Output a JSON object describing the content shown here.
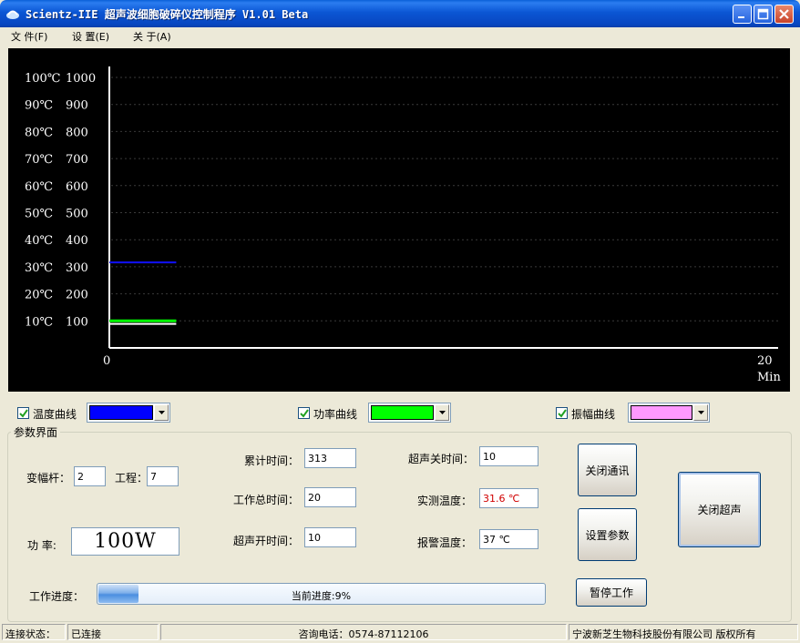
{
  "window": {
    "title": "Scientz-IIE 超声波细胞破碎仪控制程序 V1.01 Beta",
    "accent": "#0b56d4"
  },
  "menu": [
    {
      "label": "文 件(F)"
    },
    {
      "label": "设 置(E)"
    },
    {
      "label": "关 于(A)"
    }
  ],
  "chart_data": {
    "type": "line",
    "title": "",
    "y_temperature_ticks": [
      "100℃",
      "90℃",
      "80℃",
      "70℃",
      "60℃",
      "50℃",
      "40℃",
      "30℃",
      "20℃",
      "10℃"
    ],
    "y_value_ticks": [
      "1000",
      "900",
      "800",
      "700",
      "600",
      "500",
      "400",
      "300",
      "200",
      "100"
    ],
    "y_temperature_range": [
      0,
      100
    ],
    "y_value_range": [
      0,
      1000
    ],
    "x_ticks": [
      "0",
      "20"
    ],
    "x_unit": "Min",
    "x_range": [
      0,
      20
    ],
    "grid": true,
    "background": "#000000",
    "series": [
      {
        "name": "温度曲线",
        "color": "#1010ff",
        "x": [
          0,
          2
        ],
        "y": [
          31.6,
          31.6
        ]
      },
      {
        "name": "功率曲线",
        "color": "#00ff00",
        "x": [
          0,
          2
        ],
        "y": [
          100,
          100
        ]
      },
      {
        "name": "振幅曲线",
        "color": "#ffffff",
        "x": [
          0,
          2
        ],
        "y": [
          89,
          89
        ]
      }
    ]
  },
  "legend": [
    {
      "label": "温度曲线",
      "checked": true,
      "color": "#0000ff"
    },
    {
      "label": "功率曲线",
      "checked": true,
      "color": "#00ff00"
    },
    {
      "label": "振幅曲线",
      "checked": true,
      "color": "#ff99ff"
    }
  ],
  "params": {
    "group_title": "参数界面",
    "horn_label": "变幅杆：",
    "horn_value": "2",
    "process_label": "工程：",
    "process_value": "7",
    "power_label": "功  率:",
    "power_value": "100W",
    "cumulative_time_label": "累计时间：",
    "cumulative_time_value": "313",
    "total_work_time_label": "工作总时间：",
    "total_work_time_value": "20",
    "ultra_on_time_label": "超声开时间：",
    "ultra_on_time_value": "10",
    "ultra_off_time_label": "超声关时间：",
    "ultra_off_time_value": "10",
    "measured_temp_label": "实测温度：",
    "measured_temp_value": "31.6 ℃",
    "alarm_temp_label": "报警温度：",
    "alarm_temp_value": "37 ℃"
  },
  "buttons": {
    "close_comm": "关闭通讯",
    "set_params": "设置参数",
    "close_ultrasound": "关闭超声",
    "pause_work": "暂停工作"
  },
  "progress": {
    "label": "工作进度：",
    "text": "当前进度:9%",
    "fraction": 0.09
  },
  "status": {
    "conn_label": "连接状态：",
    "conn_value": "已连接",
    "phone": "咨询电话：0574-87112106",
    "company": "宁波新芝生物科技股份有限公司 版权所有"
  }
}
